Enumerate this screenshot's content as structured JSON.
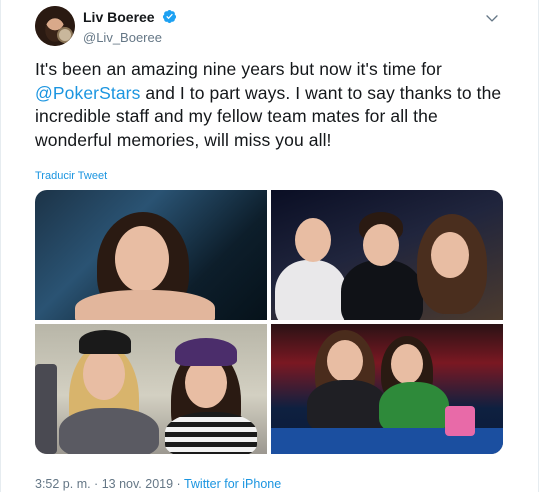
{
  "user": {
    "display_name": "Liv Boeree",
    "handle": "@Liv_Boeree",
    "verified": true,
    "avatar_icon": "profile-avatar"
  },
  "tweet": {
    "text_before": "It's been an amazing nine years but now it's time for ",
    "mention": "@PokerStars",
    "text_after": " and I to part ways. I want to say thanks to the incredible staff and my fellow team mates for all the wonderful memories, will miss you all!",
    "translate_label": "Traducir Tweet"
  },
  "media": {
    "count": 4,
    "photos": [
      "photo-1",
      "photo-2",
      "photo-3",
      "photo-4"
    ]
  },
  "meta": {
    "timestamp": "3:52 p. m. · 13 nov. 2019 · ",
    "source": "Twitter for iPhone"
  },
  "colors": {
    "link": "#1b95e0",
    "secondary_text": "#657786",
    "primary_text": "#14171a"
  },
  "icons": {
    "verified": "verified-badge-icon",
    "menu": "chevron-down-icon"
  }
}
